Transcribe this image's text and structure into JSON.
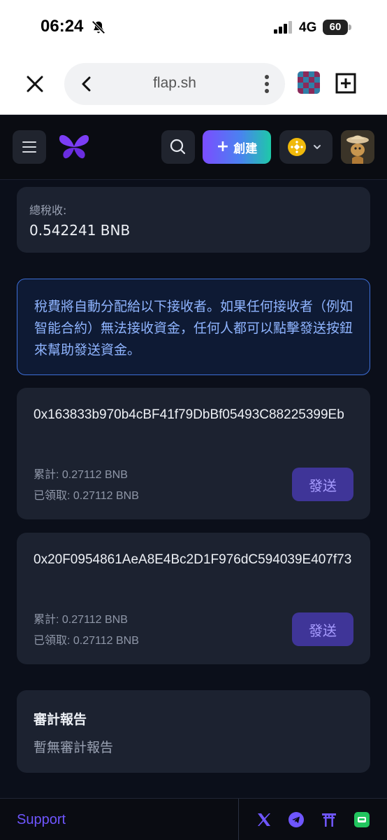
{
  "status_bar": {
    "time": "06:24",
    "network": "4G",
    "battery": "60"
  },
  "browser": {
    "url": "flap.sh"
  },
  "header": {
    "create_label": "創建"
  },
  "tax": {
    "label": "總稅收:",
    "value": "0.542241 BNB"
  },
  "notice": {
    "text": "稅費將自動分配給以下接收者。如果任何接收者（例如智能合約）無法接收資金，任何人都可以點擊發送按鈕來幫助發送資金。"
  },
  "receivers": [
    {
      "address": "0x163833b970b4cBF41f79DbBf05493C88225399Eb",
      "accumulated": "累計: 0.27112 BNB",
      "claimed": "已領取: 0.27112 BNB",
      "send_label": "發送"
    },
    {
      "address": "0x20F0954861AeA8E4Bc2D1F976dC594039E407f73",
      "accumulated": "累計: 0.27112 BNB",
      "claimed": "已領取: 0.27112 BNB",
      "send_label": "發送"
    }
  ],
  "audit": {
    "title": "審計報告",
    "empty": "暫無審計報告"
  },
  "footer": {
    "support": "Support",
    "icons": [
      "x-icon",
      "telegram-icon",
      "torii-gate-icon",
      "chat-icon"
    ]
  },
  "colors": {
    "accent": "#7b4dff",
    "send_button": "#3f3598",
    "notice_border": "#3d6ed6",
    "bnb": "#f0b90b"
  }
}
